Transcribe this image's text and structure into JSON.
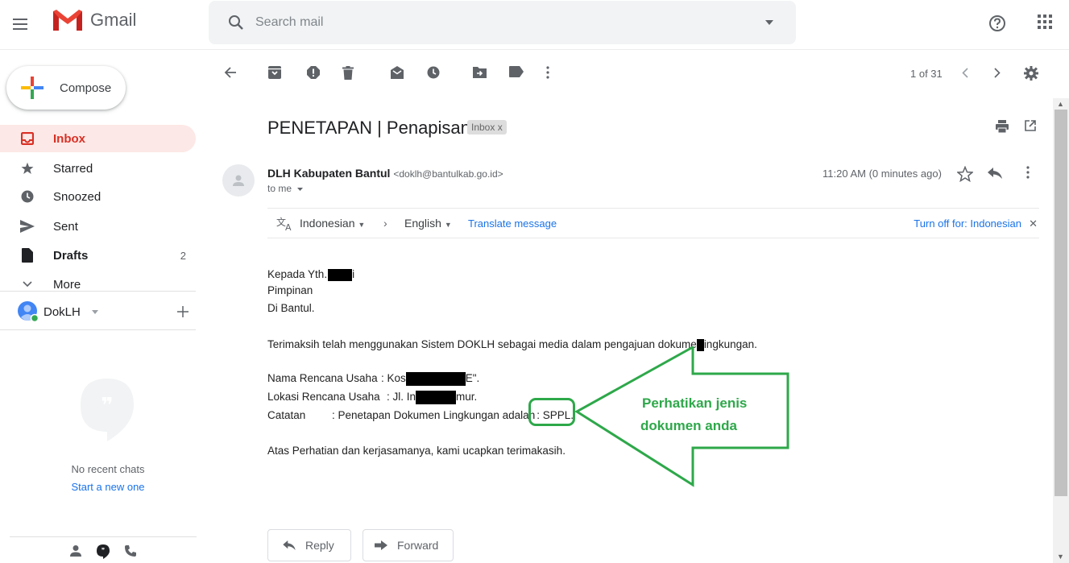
{
  "header": {
    "app_name": "Gmail",
    "search_placeholder": "Search mail"
  },
  "sidebar": {
    "compose_label": "Compose",
    "items": [
      {
        "label": "Inbox",
        "count": ""
      },
      {
        "label": "Starred",
        "count": ""
      },
      {
        "label": "Snoozed",
        "count": ""
      },
      {
        "label": "Sent",
        "count": ""
      },
      {
        "label": "Drafts",
        "count": "2"
      },
      {
        "label": "More",
        "count": ""
      }
    ],
    "account_name": "DokLH",
    "no_chats": "No recent chats",
    "start_new": "Start a new one"
  },
  "toolbar": {
    "page_count": "1 of 31"
  },
  "message": {
    "subject": "PENETAPAN | Penapisan",
    "label_chip": "Inbox x",
    "sender_name": "DLH Kabupaten Bantul",
    "sender_email": "<doklh@bantulkab.go.id>",
    "to": "to me",
    "time": "11:20 AM (0 minutes ago)",
    "translate": {
      "from": "Indonesian",
      "to": "English",
      "translate_link": "Translate message",
      "turn_off": "Turn off for: Indonesian"
    },
    "body": {
      "l1a": "Kepada Yth.",
      "l1b": "i",
      "l2": "Pimpinan",
      "l3": "Di Bantul.",
      "l4a": "Terimaksih telah menggunakan Sistem DOKLH sebagai media dalam pengajuan dokume",
      "l4b": "ingkungan.",
      "l5a": "Nama Rencana Usaha",
      "l5b": ": Kos",
      "l5c": "E\".",
      "l6a": "Lokasi Rencana Usaha",
      "l6b": ": Jl. In",
      "l6c": "mur.",
      "l7a": "Catatan",
      "l7b": ": Penetapan Dokumen Lingkungan adalah",
      "l7c": ": SPPL.",
      "l8": "Atas Perhatian dan kerjasamanya, kami ucapkan terimakasih."
    },
    "annotation_line1": "Perhatikan jenis",
    "annotation_line2": "dokumen anda",
    "reply_label": "Reply",
    "forward_label": "Forward"
  },
  "colors": {
    "accent_red": "#d93025",
    "annotation_green": "#2ea84a",
    "link_blue": "#1a73e8"
  }
}
